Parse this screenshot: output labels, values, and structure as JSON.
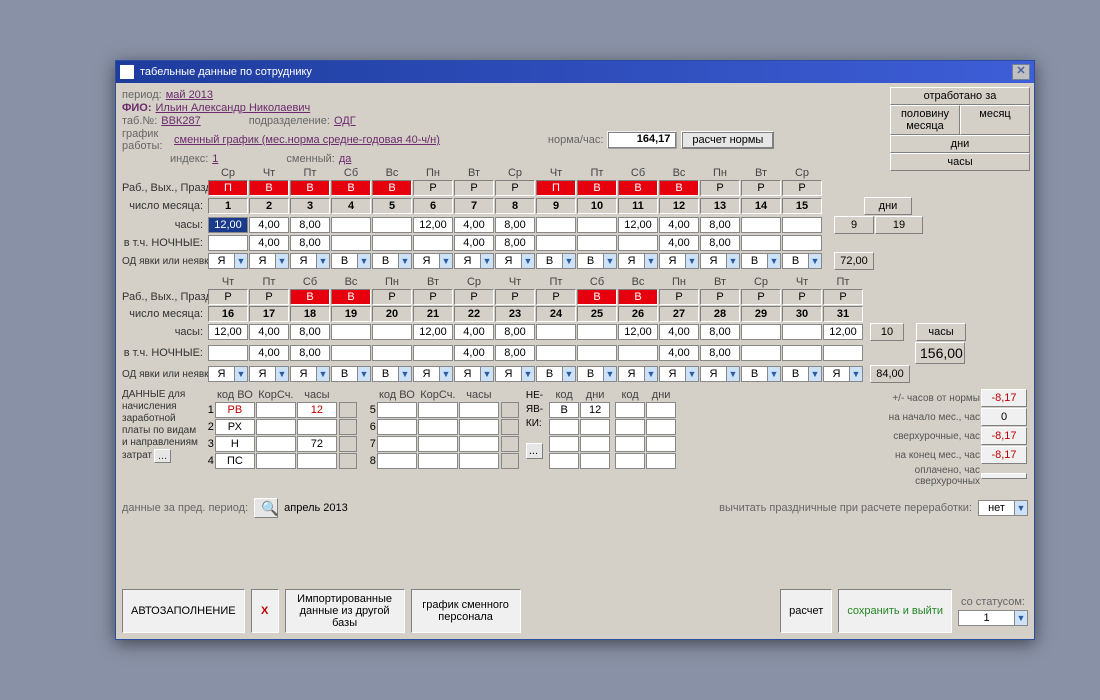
{
  "title": "табельные данные  по сотруднику",
  "hdr": {
    "period_l": "период:",
    "period_v": "май 2013",
    "fio_l": "ФИО:",
    "fio_v": "Ильин Александр Николаевич",
    "tab_l": "таб.№:",
    "tab_v": "ВВК287",
    "dep_l": "подразделение:",
    "dep_v": "ОДГ",
    "sched_l": "график работы:",
    "sched_v": "сменный график (мес.норма средне-годовая 40-ч/н)",
    "idx_l": "индекс:",
    "idx_v": "1",
    "shift_l": "сменный:",
    "shift_v": "да",
    "norm_l": "норма/час:",
    "norm_v": "164,17",
    "norm_btn": "расчет нормы"
  },
  "rowlabels": {
    "rvp": "Раб., Вых., Празд.:",
    "dom": "число месяца:",
    "hours": "часы:",
    "night": "в т.ч. НОЧНЫЕ:",
    "attend": "ОД явки или неявки"
  },
  "dow1": [
    "Ср",
    "Чт",
    "Пт",
    "Сб",
    "Вс",
    "Пн",
    "Вт",
    "Ср",
    "Чт",
    "Пт",
    "Сб",
    "Вс",
    "Пн",
    "Вт",
    "Ср"
  ],
  "rvp1": [
    "П",
    "В",
    "В",
    "В",
    "В",
    "Р",
    "Р",
    "Р",
    "П",
    "В",
    "В",
    "В",
    "Р",
    "Р",
    "Р"
  ],
  "rvp1_type": [
    "R",
    "R",
    "R",
    "R",
    "R",
    "",
    "",
    "",
    "R",
    "R",
    "R",
    "R",
    "",
    "",
    ""
  ],
  "dom1": [
    "1",
    "2",
    "3",
    "4",
    "5",
    "6",
    "7",
    "8",
    "9",
    "10",
    "11",
    "12",
    "13",
    "14",
    "15"
  ],
  "h1": [
    "12,00",
    "4,00",
    "8,00",
    "",
    "",
    "12,00",
    "4,00",
    "8,00",
    "",
    "",
    "12,00",
    "4,00",
    "8,00",
    "",
    ""
  ],
  "n1": [
    "",
    "4,00",
    "8,00",
    "",
    "",
    "",
    "4,00",
    "8,00",
    "",
    "",
    "",
    "4,00",
    "8,00",
    "",
    ""
  ],
  "att1": [
    "Я",
    "Я",
    "Я",
    "В",
    "В",
    "Я",
    "Я",
    "Я",
    "В",
    "В",
    "Я",
    "Я",
    "Я",
    "В",
    "В"
  ],
  "att1_g": [
    "",
    "",
    "",
    "G",
    "G",
    "",
    "",
    "",
    "G",
    "G",
    "",
    "",
    "",
    "G",
    "G"
  ],
  "h1_sel": 0,
  "sum1": {
    "days": "9",
    "days_l": "дни",
    "half": "19",
    "hours": "72,00"
  },
  "dow2": [
    "Чт",
    "Пт",
    "Сб",
    "Вс",
    "Пн",
    "Вт",
    "Ср",
    "Чт",
    "Пт",
    "Сб",
    "Вс",
    "Пн",
    "Вт",
    "Ср",
    "Чт",
    "Пт"
  ],
  "rvp2": [
    "Р",
    "Р",
    "В",
    "В",
    "Р",
    "Р",
    "Р",
    "Р",
    "Р",
    "В",
    "В",
    "Р",
    "Р",
    "Р",
    "Р",
    "Р"
  ],
  "rvp2_type": [
    "",
    "",
    "R",
    "R",
    "",
    "",
    "",
    "",
    "",
    "R",
    "R",
    "",
    "",
    "",
    "",
    ""
  ],
  "dom2": [
    "16",
    "17",
    "18",
    "19",
    "20",
    "21",
    "22",
    "23",
    "24",
    "25",
    "26",
    "27",
    "28",
    "29",
    "30",
    "31"
  ],
  "h2": [
    "12,00",
    "4,00",
    "8,00",
    "",
    "",
    "12,00",
    "4,00",
    "8,00",
    "",
    "",
    "12,00",
    "4,00",
    "8,00",
    "",
    "",
    "12,00"
  ],
  "n2": [
    "",
    "4,00",
    "8,00",
    "",
    "",
    "",
    "4,00",
    "8,00",
    "",
    "",
    "",
    "4,00",
    "8,00",
    "",
    "",
    ""
  ],
  "att2": [
    "Я",
    "Я",
    "Я",
    "В",
    "В",
    "Я",
    "Я",
    "Я",
    "В",
    "В",
    "Я",
    "Я",
    "Я",
    "В",
    "В",
    "Я"
  ],
  "att2_g": [
    "",
    "",
    "",
    "G",
    "G",
    "",
    "",
    "",
    "G",
    "G",
    "",
    "",
    "",
    "G",
    "G",
    ""
  ],
  "sum2": {
    "month": "10",
    "hours_l": "часы",
    "total": "156,00",
    "sumh": "84,00"
  },
  "worked": {
    "hdr": "отработано за",
    "half": "половину месяца",
    "month": "месяц",
    "days": "дни",
    "hours": "часы"
  },
  "payhead": {
    "t1": "ДАННЫЕ для",
    "t2": "начисления",
    "t3": "заработной",
    "t4": "платы по видам",
    "t5": "и направлениям",
    "t6": "затрат",
    "c1": "код ВО",
    "c2": "КорСч.",
    "c3": "часы"
  },
  "pay1": [
    {
      "n": "1",
      "code": "РВ",
      "acc": "",
      "hrs": "12",
      "r": true
    },
    {
      "n": "2",
      "code": "РХ",
      "acc": "",
      "hrs": ""
    },
    {
      "n": "3",
      "code": "Н",
      "acc": "",
      "hrs": "72"
    },
    {
      "n": "4",
      "code": "ПС",
      "acc": "",
      "hrs": ""
    }
  ],
  "pay2": [
    {
      "n": "5",
      "code": "",
      "acc": "",
      "hrs": ""
    },
    {
      "n": "6",
      "code": "",
      "acc": "",
      "hrs": ""
    },
    {
      "n": "7",
      "code": "",
      "acc": "",
      "hrs": ""
    },
    {
      "n": "8",
      "code": "",
      "acc": "",
      "hrs": ""
    }
  ],
  "absent": {
    "hdr1": "НЕ-",
    "hdr2": "ЯВ-",
    "hdr3": "КИ:",
    "code_l": "код",
    "days_l": "дни",
    "rows": [
      {
        "code": "В",
        "days": "12"
      },
      {
        "code": "",
        "days": ""
      },
      {
        "code": "",
        "days": ""
      },
      {
        "code": "",
        "days": ""
      }
    ]
  },
  "absent2": {
    "code_l": "код",
    "days_l": "дни",
    "rows": [
      {
        "code": "",
        "days": ""
      },
      {
        "code": "",
        "days": ""
      },
      {
        "code": "",
        "days": ""
      },
      {
        "code": "",
        "days": ""
      }
    ]
  },
  "totals": {
    "r1l": "+/- часов от нормы",
    "r1v": "-8,17",
    "r2l": "на начало мес., час",
    "r2v": "0",
    "r3l": "сверхурочные, час",
    "r3v": "-8,17",
    "r4l": "на конец мес., час",
    "r4v": "-8,17",
    "r5l": "оплачено,    час сверхурочных",
    "r5v": ""
  },
  "prev": {
    "l": "данные за пред. период:",
    "v": "апрель 2013"
  },
  "holiday": {
    "l": "вычитать праздничные при расчете переработки:",
    "v": "нет"
  },
  "foot": {
    "auto": "АВТОЗАПОЛНЕНИЕ",
    "x": "X",
    "imp": "Импортированные данные из другой базы",
    "sched": "график сменного персонала",
    "calc": "расчет",
    "save": "сохранить и выйти",
    "status_l": "со статусом:",
    "status_v": "1"
  }
}
